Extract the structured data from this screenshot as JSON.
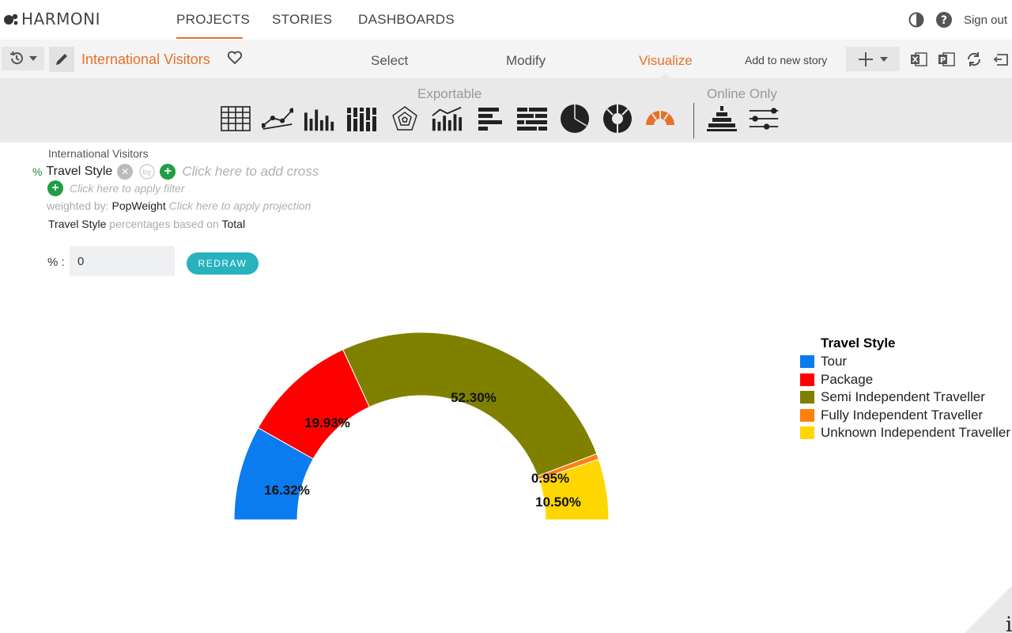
{
  "app": {
    "logo_text": "HARMONI"
  },
  "nav": {
    "projects": "PROJECTS",
    "stories": "STORIES",
    "dashboards": "DASHBOARDS",
    "sign_out": "Sign out"
  },
  "toolbar": {
    "project_title": "International Visitors",
    "tabs": {
      "select": "Select",
      "modify": "Modify",
      "visualize": "Visualize"
    },
    "add_to_story": "Add to new story"
  },
  "strip": {
    "exportable_label": "Exportable",
    "online_only_label": "Online Only"
  },
  "query": {
    "source": "International Visitors",
    "percent_symbol": "%",
    "variable": "Travel Style",
    "add_cross_hint": "Click here to add cross",
    "filter_hint": "Click here to apply filter",
    "weighted_by_label": "weighted by:",
    "weight_var": "PopWeight",
    "projection_hint": "Click here to apply projection",
    "pct_var": "Travel Style",
    "pct_based_on_label": "percentages based on",
    "pct_base": "Total"
  },
  "controls": {
    "pct_label": "% :",
    "pct_value": "0",
    "redraw_label": "REDRAW"
  },
  "chart_data": {
    "type": "pie",
    "subtype": "semi-donut",
    "legend_title": "Travel Style",
    "legend_placement": "right",
    "categories": [
      "Tour",
      "Package",
      "Semi Independent Traveller",
      "Fully Independent Traveller",
      "Unknown Independent Traveller"
    ],
    "values": [
      16.32,
      19.93,
      52.3,
      0.95,
      10.5
    ],
    "labels": [
      "16.32%",
      "19.93%",
      "52.30%",
      "0.95%",
      "10.50%"
    ],
    "colors": [
      "#0a7cf0",
      "#ff0000",
      "#808000",
      "#ff7f0e",
      "#ffd700"
    ]
  },
  "colors": {
    "accent": "#e8702a",
    "redraw": "#28b2bd",
    "plus_green": "#1f9e45"
  }
}
